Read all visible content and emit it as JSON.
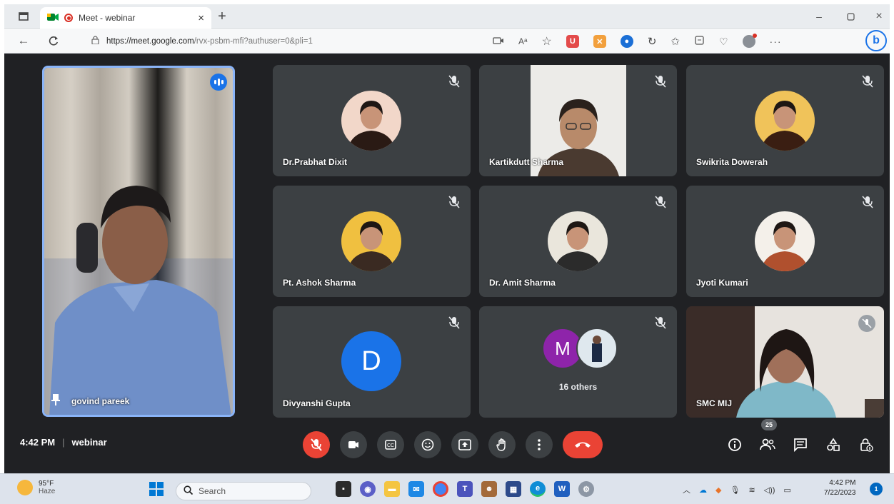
{
  "browser": {
    "tab_title": "Meet - webinar",
    "url_host": "https://meet.google.com",
    "url_path": "/rvx-psbm-mfi?authuser=0&pli=1",
    "read_aloud": "Aᵃ"
  },
  "meet": {
    "pinned": {
      "name": "govind pareek"
    },
    "tiles": [
      {
        "name": "Dr.Prabhat Dixit"
      },
      {
        "name": "Kartikdutt Sharma"
      },
      {
        "name": "Swikrita Dowerah"
      },
      {
        "name": "Pt. Ashok Sharma"
      },
      {
        "name": "Dr. Amit Sharma"
      },
      {
        "name": "Jyoti Kumari"
      },
      {
        "name": "Divyanshi Gupta",
        "initial": "D"
      },
      {
        "name": "16 others",
        "initial": "M"
      },
      {
        "name": "SMC MIJ"
      }
    ],
    "footer": {
      "time": "4:42 PM",
      "separator": "|",
      "meeting_name": "webinar",
      "people_count": "25"
    },
    "colors": {
      "end_call": "#ea4335",
      "mic_off": "#ea4335",
      "bg": "#202124",
      "tile": "#3c4043",
      "avatar_d": "#1a73e8",
      "avatar_m": "#8e24aa"
    }
  },
  "taskbar": {
    "weather_temp": "95°F",
    "weather_desc": "Haze",
    "search_placeholder": "Search",
    "clock_time": "4:42 PM",
    "clock_date": "7/22/2023",
    "notification_count": "1"
  }
}
